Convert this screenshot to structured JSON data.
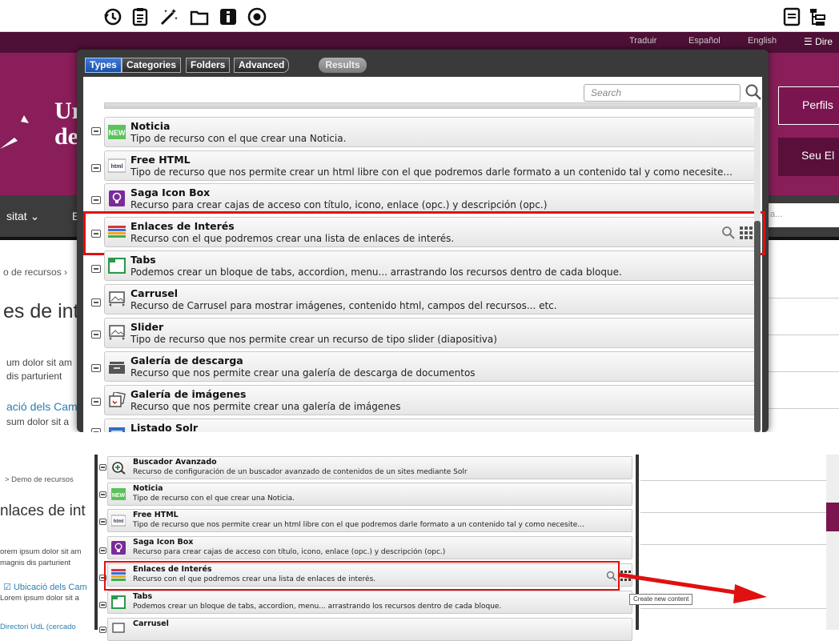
{
  "toolbar": {
    "icons": [
      "history-icon",
      "clipboard-icon",
      "magic-wand-icon",
      "folder-icon",
      "info-icon",
      "target-icon"
    ],
    "right_icons": [
      "list-view-icon",
      "tree-view-icon"
    ]
  },
  "site": {
    "top_links": [
      "Traduir",
      "Español",
      "English"
    ],
    "directory": "Dire",
    "logo_line1": "Ur",
    "logo_line2": "de",
    "btn_perfils": "Perfils",
    "btn_seu": "Seu El",
    "nav_item": "sitat",
    "nav_b": "E",
    "search_hint": "a...",
    "breadcrumb": "o de recursos",
    "title": "es de int",
    "p1": "um dolor sit am",
    "p2": "dis parturient",
    "link": "ació dels Cam",
    "p3": "sum dolor sit a"
  },
  "panel": {
    "tabs": [
      "Types",
      "Categories",
      "Folders",
      "Advanced"
    ],
    "results": "Results",
    "search_placeholder": "Search",
    "items": [
      {
        "title": "Noticia",
        "desc": "Tipo de recurso con el que crear una Noticia."
      },
      {
        "title": "Free HTML",
        "desc": "Tipo de recurso que nos permite crear un html libre con el que podremos darle formato a un contenido tal y como necesite..."
      },
      {
        "title": "Saga Icon Box",
        "desc": "Recurso para crear cajas de acceso con título, icono, enlace (opc.) y descripción (opc.)"
      },
      {
        "title": "Enlaces de Interés",
        "desc": "Recurso con el que podremos crear una lista de enlaces de interés."
      },
      {
        "title": "Tabs",
        "desc": "Podemos crear un bloque de tabs, accordion, menu... arrastrando los recursos dentro de cada bloque."
      },
      {
        "title": "Carrusel",
        "desc": "Recurso de Carrusel para mostrar imágenes, contenido html, campos del recursos... etc."
      },
      {
        "title": "Slider",
        "desc": "Tipo de recurso que nos permite crear un recurso de tipo slider (diapositiva)"
      },
      {
        "title": "Galería de descarga",
        "desc": "Recurso que nos permite crear una galería de descarga de documentos"
      },
      {
        "title": "Galería de imágenes",
        "desc": "Recurso que nos permite crear una galería de imágenes"
      },
      {
        "title": "Listado Solr",
        "desc": ""
      }
    ]
  },
  "bottom": {
    "breadcrumb": "> Demo de recursos",
    "title": "nlaces de int",
    "p1": "orem ipsum dolor sit am",
    "p2": "magnis dis parturient",
    "link": "Ubicació dels Cam",
    "p3": "Lorem ipsum dolor sit a",
    "p4": "Directori UdL (cercado",
    "items": [
      {
        "title": "Buscador Avanzado",
        "desc": "Recurso de configuración de un buscador avanzado de contenidos de un sites mediante Solr"
      },
      {
        "title": "Noticia",
        "desc": "Tipo de recurso con el que crear una Noticia."
      },
      {
        "title": "Free HTML",
        "desc": "Tipo de recurso que nos permite crear un html libre con el que podremos darle formato a un contenido tal y como necesite..."
      },
      {
        "title": "Saga Icon Box",
        "desc": "Recurso para crear cajas de acceso con título, icono, enlace (opc.) y descripción (opc.)"
      },
      {
        "title": "Enlaces de Interés",
        "desc": "Recurso con el que podremos crear una lista de enlaces de interés."
      },
      {
        "title": "Tabs",
        "desc": "Podemos crear un bloque de tabs, accordion, menu... arrastrando los recursos dentro de cada bloque."
      },
      {
        "title": "Carrusel",
        "desc": ""
      }
    ],
    "tooltip": "Create new content"
  },
  "colors": {
    "highlight": "#e01010",
    "brand": "#8a1e5a",
    "active_tab": "#2b63c4"
  }
}
